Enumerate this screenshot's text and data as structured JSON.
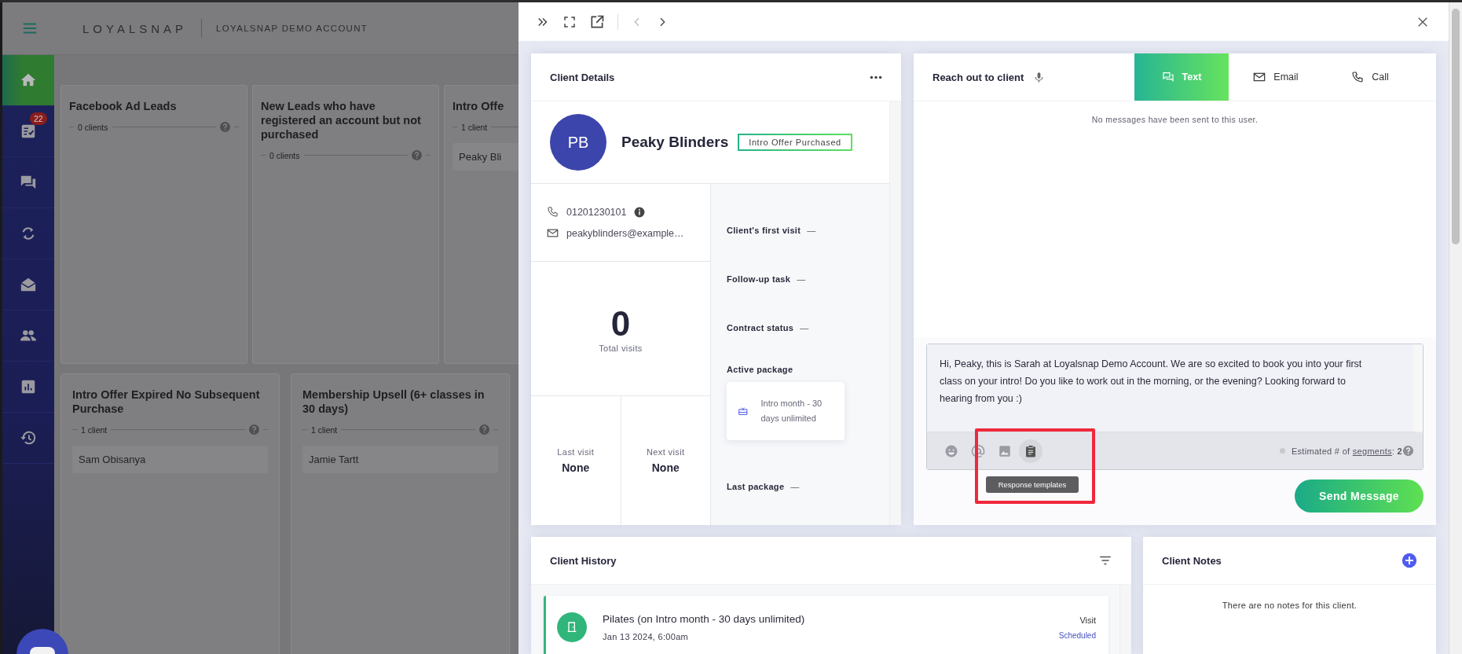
{
  "app": {
    "logo": "LOYALSNAP",
    "account": "LOYALSNAP DEMO ACCOUNT",
    "sidebar": {
      "items": [
        {
          "selected": true
        },
        {
          "selected": false,
          "badge": "22"
        },
        {
          "selected": false
        },
        {
          "selected": false
        },
        {
          "selected": false
        },
        {
          "selected": false
        },
        {
          "selected": false
        },
        {
          "selected": false
        }
      ]
    },
    "board_rows": [
      {
        "cards": [
          {
            "title": "Facebook Ad Leads",
            "count": "0 clients"
          },
          {
            "title": "New Leads who have registered an account but not purchased",
            "count": "0 clients"
          },
          {
            "title": "Intro Offe",
            "count": "1 client",
            "clients": [
              "Peaky Bli"
            ]
          }
        ]
      },
      {
        "cards": [
          {
            "title": "Intro Offer Expired No Subsequent Purchase",
            "count": "1 client",
            "clients": [
              "Sam Obisanya"
            ]
          },
          {
            "title": "Membership Upsell (6+ classes in 30 days)",
            "count": "1 client",
            "clients": [
              "Jamie Tartt"
            ]
          }
        ]
      }
    ]
  },
  "client_details": {
    "title": "Client Details",
    "initials": "PB",
    "name": "Peaky Blinders",
    "tag": "Intro Offer Purchased",
    "phone": "01201230101",
    "email": "peakyblinders@example…",
    "total_visits": "0",
    "total_visits_label": "Total visits",
    "visits": [
      {
        "label": "Last visit",
        "value": "None"
      },
      {
        "label": "Next visit",
        "value": "None"
      }
    ],
    "fields": [
      {
        "kind": "plain",
        "label": "Client's first visit",
        "value": "—"
      },
      {
        "kind": "plain",
        "label": "Follow-up task",
        "value": "—"
      },
      {
        "kind": "plain",
        "label": "Contract status",
        "value": "—"
      },
      {
        "kind": "package",
        "label": "Active package",
        "value": "Intro month - 30 days unlimited"
      },
      {
        "kind": "plain",
        "label": "Last package",
        "value": "—"
      }
    ]
  },
  "reach_out": {
    "title": "Reach out to client",
    "tabs": [
      {
        "label": "Text",
        "selected": true
      },
      {
        "label": "Email",
        "selected": false
      },
      {
        "label": "Call",
        "selected": false
      }
    ],
    "empty_text": "No messages have been sent to this user.",
    "message": "Hi, Peaky, this is Sarah at Loyalsnap Demo Account. We are so excited to book you into your first class on your intro! Do you like to work out in the morning, or the evening? Looking forward to hearing from you :)",
    "segments": {
      "prefix": "Estimated # of ",
      "link": "segments",
      "suffix": ": **2**"
    },
    "tooltip": "Response templates",
    "send_button": "Send Message"
  },
  "client_history": {
    "title": "Client History",
    "items": [
      {
        "title": "Pilates (on Intro month - 30 days unlimited)",
        "date": "Jan 13 2024, 6:00am",
        "type": "Visit",
        "status": "Scheduled"
      }
    ]
  },
  "client_notes": {
    "title": "Client Notes",
    "empty_text": "There are no notes for this client."
  }
}
